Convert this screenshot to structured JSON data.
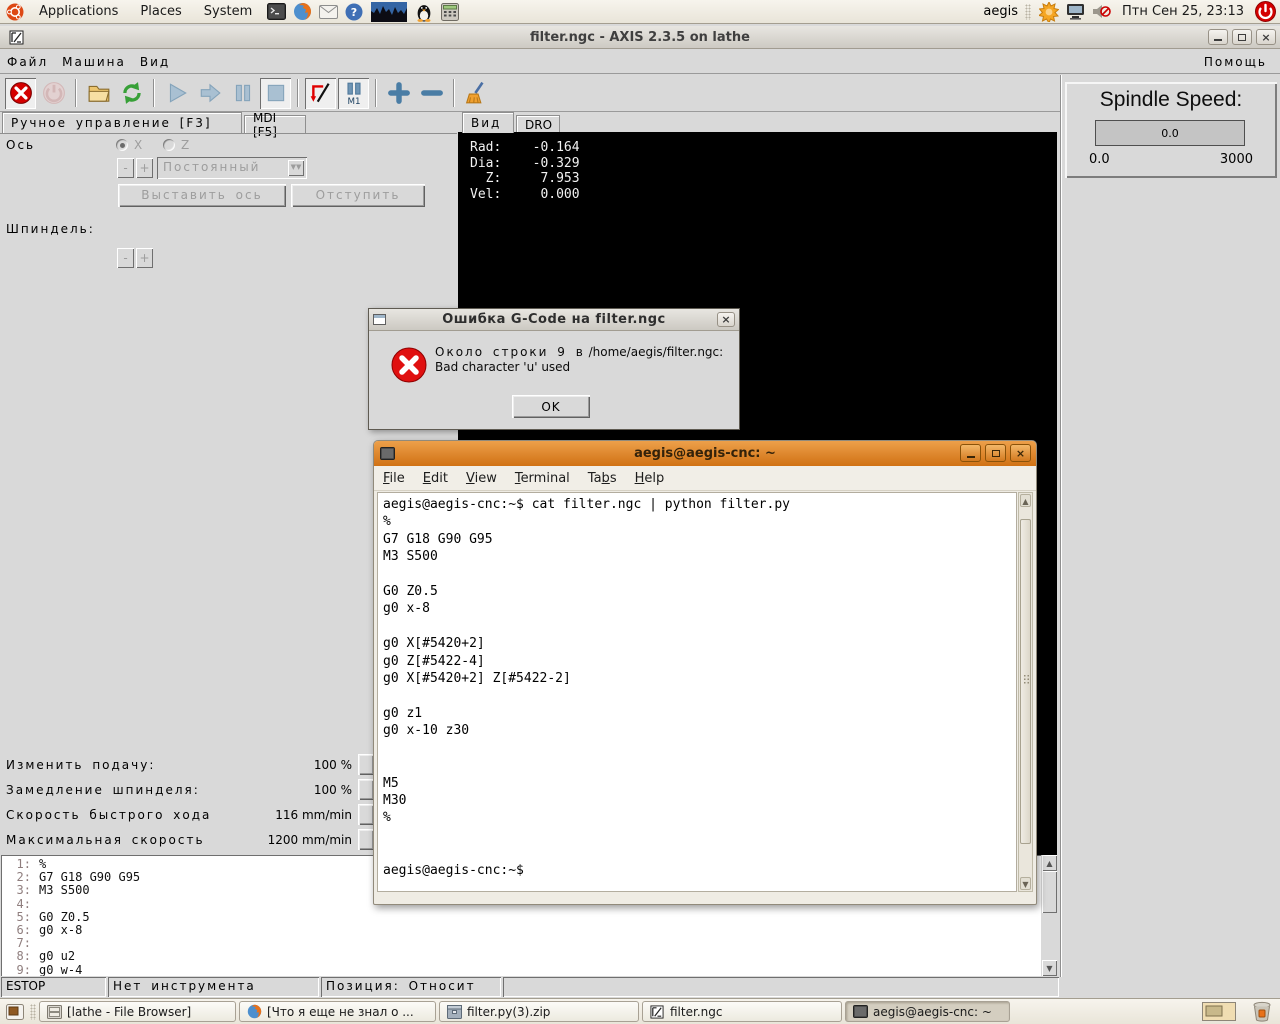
{
  "desktop": {
    "top_panel": {
      "menus": [
        {
          "label": "Applications"
        },
        {
          "label": "Places"
        },
        {
          "label": "System"
        }
      ],
      "username": "aegis",
      "clock": "Птн Сен 25, 23:13"
    },
    "taskbar": {
      "items": [
        {
          "label": "[lathe - File Browser]"
        },
        {
          "label": "[Что я еще не знал о ..."
        },
        {
          "label": "filter.py(3).zip"
        },
        {
          "label": "filter.ngc"
        },
        {
          "label": "aegis@aegis-cnc: ~"
        }
      ]
    }
  },
  "axis": {
    "title": "filter.ngc - AXIS 2.3.5 on lathe",
    "menubar": {
      "items": [
        {
          "label": "Файл"
        },
        {
          "label": "Машина"
        },
        {
          "label": "Вид"
        }
      ],
      "help": "Помощь"
    },
    "tabs": {
      "manual": "Ручное управление [F3]",
      "mdi": "MDI [F5]"
    },
    "manual": {
      "axis_label": "Ось",
      "axis_x": "X",
      "axis_z": "Z",
      "minus": "-",
      "plus": "+",
      "jog_mode": "Постоянный",
      "home_axis": "Выставить ось",
      "touch_off": "Отступить",
      "spindle_label": "Шпиндель:"
    },
    "preview_tabs": {
      "view": "Вид",
      "dro": "DRO"
    },
    "dro_text": "Rad:    -0.164\nDia:    -0.329\n  Z:     7.953\nVel:     0.000",
    "spindle_panel": {
      "title": "Spindle Speed:",
      "value": "0.0",
      "min": "0.0",
      "max": "3000"
    },
    "toolbar_m1": "M1",
    "overrides": [
      {
        "label": "Изменить подачу:",
        "value": "100 %"
      },
      {
        "label": "Замедление шпинделя:",
        "value": "100 %"
      },
      {
        "label": "Скорость быстрого хода",
        "value": "116 mm/min"
      },
      {
        "label": "Максимальная скорость",
        "value": "1200 mm/min"
      }
    ],
    "gcode": [
      {
        "n": "1:",
        "t": "%"
      },
      {
        "n": "2:",
        "t": "G7 G18 G90 G95"
      },
      {
        "n": "3:",
        "t": "M3 S500"
      },
      {
        "n": "4:",
        "t": ""
      },
      {
        "n": "5:",
        "t": "G0 Z0.5"
      },
      {
        "n": "6:",
        "t": "g0 x-8"
      },
      {
        "n": "7:",
        "t": ""
      },
      {
        "n": "8:",
        "t": "g0 u2"
      },
      {
        "n": "9:",
        "t": "g0 w-4"
      }
    ],
    "status": {
      "estop": "ESTOP",
      "tool": "Нет инструмента",
      "position": "Позиция: Относит"
    }
  },
  "error_dialog": {
    "title": "Ошибка G-Code на filter.ngc",
    "message_ru": "Около строки 9 в",
    "message_path": " /home/aegis/filter.ngc:",
    "message_detail": "Bad character 'u' used",
    "ok_label": "OK"
  },
  "terminal": {
    "title": "aegis@aegis-cnc: ~",
    "menu": [
      {
        "pre": "",
        "u": "F",
        "rest": "ile"
      },
      {
        "pre": "",
        "u": "E",
        "rest": "dit"
      },
      {
        "pre": "",
        "u": "V",
        "rest": "iew"
      },
      {
        "pre": "",
        "u": "T",
        "rest": "erminal"
      },
      {
        "pre": "Ta",
        "u": "b",
        "rest": "s"
      },
      {
        "pre": "",
        "u": "H",
        "rest": "elp"
      }
    ],
    "content": "aegis@aegis-cnc:~$ cat filter.ngc | python filter.py\n%\nG7 G18 G90 G95\nM3 S500\n\nG0 Z0.5\ng0 x-8\n\ng0 X[#5420+2]\ng0 Z[#5422-4]\ng0 X[#5420+2] Z[#5422-2]\n\ng0 z1\ng0 x-10 z30\n\n\nM5\nM30\n%\n\n\naegis@aegis-cnc:~$ "
  },
  "colors": {
    "accent_orange": "#D07114",
    "error_red": "#CC0000",
    "panel_tan": "#EDEADF",
    "steel_blue": "#4A7DA5"
  }
}
